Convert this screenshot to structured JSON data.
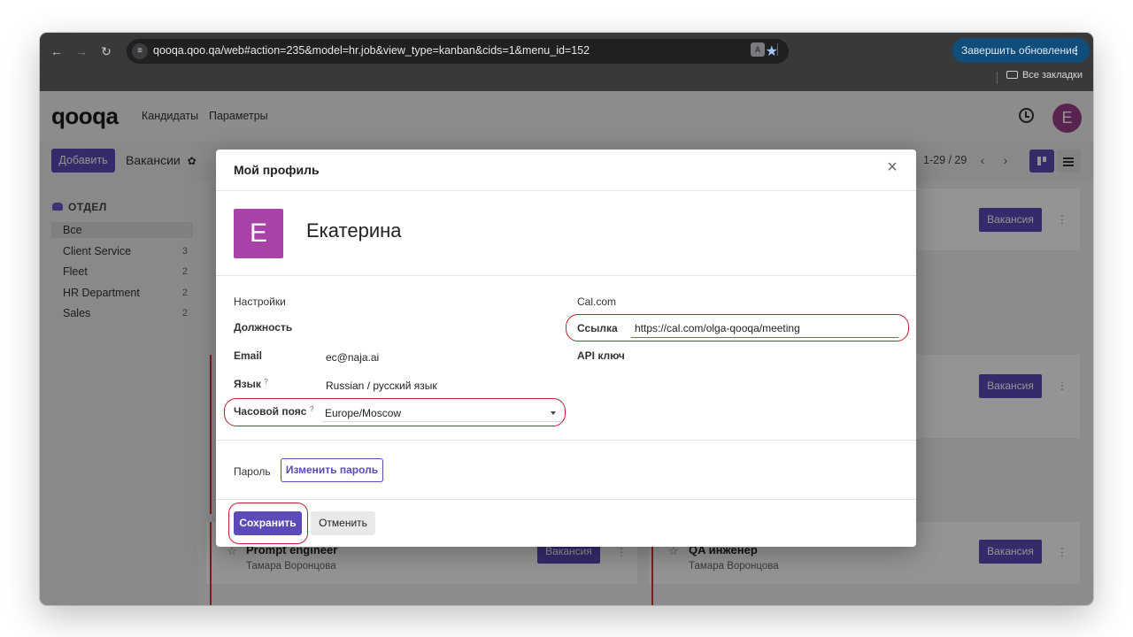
{
  "browser": {
    "url": "qooqa.qoo.qa/web#action=235&model=hr.job&view_type=kanban&cids=1&menu_id=152",
    "update_label": "Завершить обновление",
    "bookmarks_label": "Все закладки"
  },
  "app": {
    "logo": "qooqa",
    "menu": [
      "Кандидаты",
      "Параметры"
    ],
    "avatar_letter": "E",
    "add_label": "Добавить",
    "breadcrumb": "Вакансии",
    "pager": "1-29 / 29"
  },
  "sidebar": {
    "title": "ОТДЕЛ",
    "items": [
      {
        "label": "Все",
        "count": ""
      },
      {
        "label": "Client Service",
        "count": "3"
      },
      {
        "label": "Fleet",
        "count": "2"
      },
      {
        "label": "HR Department",
        "count": "2"
      },
      {
        "label": "Sales",
        "count": "2"
      }
    ]
  },
  "kanban": {
    "button_label": "Вакансия",
    "cards": [
      {
        "title": "Prompt engineer",
        "subtitle": "Тамара Воронцова"
      },
      {
        "title": "QA инженер",
        "subtitle": "Тамара Воронцова"
      }
    ]
  },
  "modal": {
    "title": "Мой профиль",
    "avatar_letter": "E",
    "name": "Екатерина",
    "settings_label": "Настройки",
    "position_label": "Должность",
    "email_label": "Email",
    "email_value": "ec@naja.ai",
    "language_label": "Язык",
    "language_value": "Russian / русский язык",
    "timezone_label": "Часовой пояс",
    "timezone_value": "Europe/Moscow",
    "calcom_label": "Cal.com",
    "link_label": "Ссылка",
    "link_value": "https://cal.com/olga-qooqa/meeting",
    "api_label": "API ключ",
    "password_label": "Пароль",
    "change_password_label": "Изменить пароль",
    "save_label": "Сохранить",
    "cancel_label": "Отменить",
    "tooltip_mark": "?"
  }
}
